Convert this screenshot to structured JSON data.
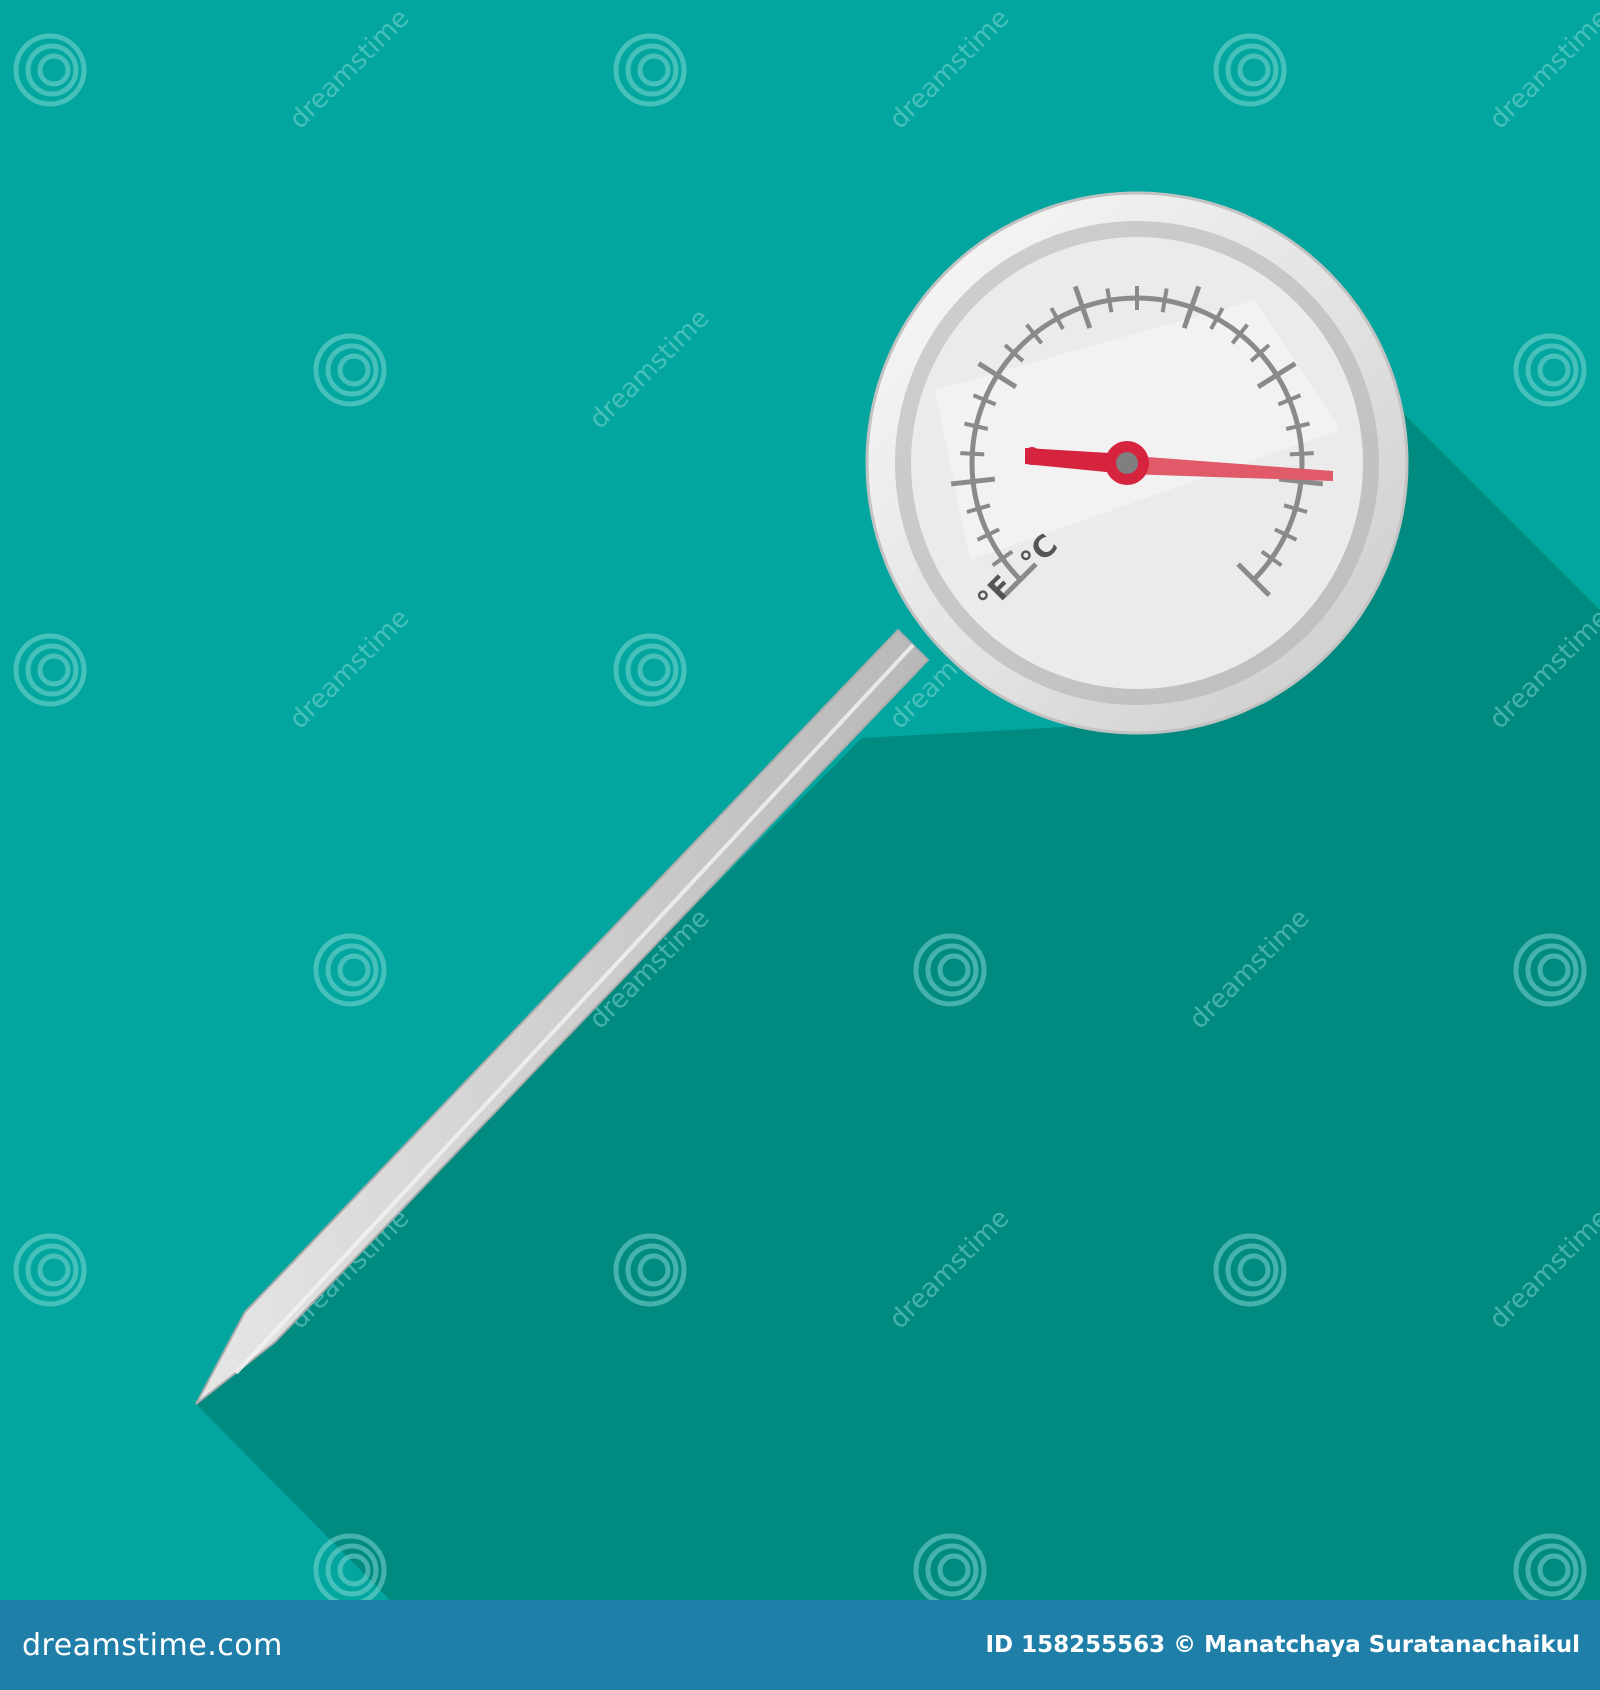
{
  "colors": {
    "background": "#02a69f",
    "shadow": "#018a80",
    "footer": "#1f7fa8",
    "metal_light": "#f2f2f2",
    "metal_mid": "#d4d4d4",
    "metal_dark": "#b4b4b4",
    "dial_face": "#ebebeb",
    "scale": "#8a8a8a",
    "needle": "#d6243e",
    "text": "#ffffff"
  },
  "icons": {
    "watermark": "dreamstime-swirl-icon"
  },
  "thermometer": {
    "unit_celsius": "°C",
    "unit_fahrenheit": "°F"
  },
  "watermark": {
    "text": "dreamstime"
  },
  "footer": {
    "brand": "dreamstime.com",
    "credit": "ID 158255563 © Manatchaya Suratanachaikul"
  }
}
